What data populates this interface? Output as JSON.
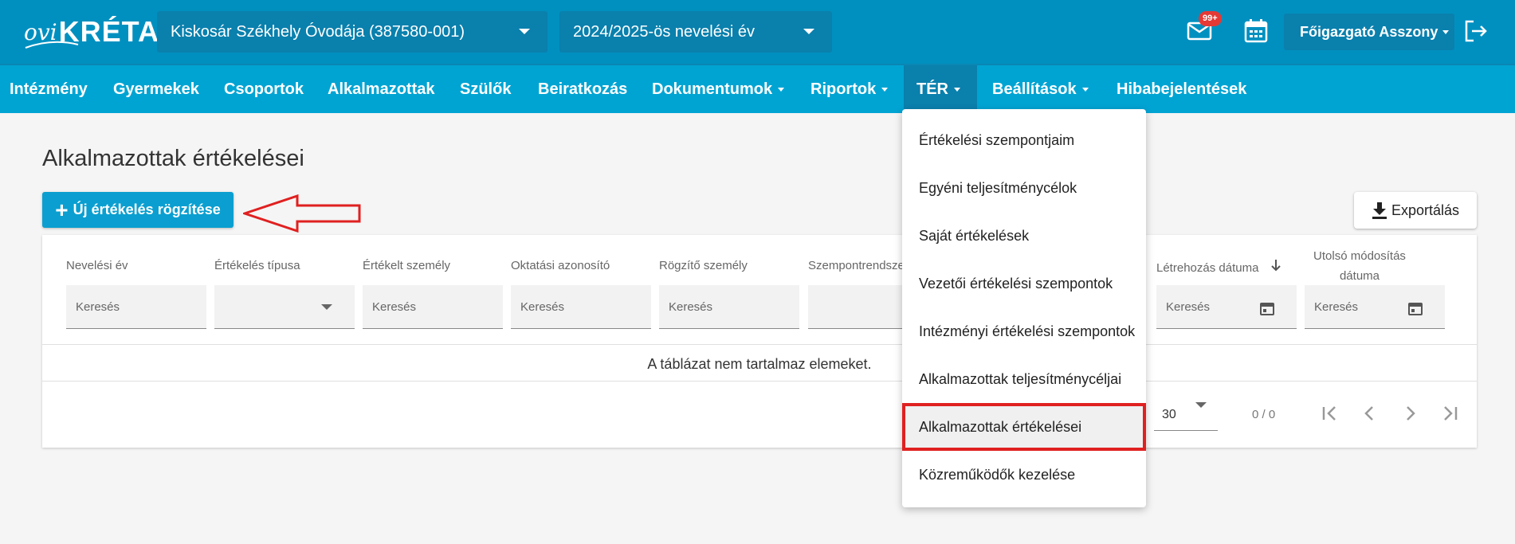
{
  "header": {
    "logo_prefix": "ovi",
    "logo_main": "KRÉTA",
    "institution": "Kiskosár Székhely Óvodája (387580-001)",
    "school_year": "2024/2025-ös nevelési év",
    "mail_badge": "99+",
    "user_name": "Főigazgató Asszony"
  },
  "nav": {
    "items": [
      {
        "label": "Intézmény"
      },
      {
        "label": "Gyermekek"
      },
      {
        "label": "Csoportok"
      },
      {
        "label": "Alkalmazottak"
      },
      {
        "label": "Szülők"
      },
      {
        "label": "Beiratkozás"
      },
      {
        "label": "Dokumentumok"
      },
      {
        "label": "Riportok"
      },
      {
        "label": "TÉR"
      },
      {
        "label": "Beállítások"
      },
      {
        "label": "Hibabejelentések"
      }
    ]
  },
  "page": {
    "title": "Alkalmazottak értékelései",
    "new_button": "Új értékelés rögzítése",
    "export_button": "Exportálás"
  },
  "table": {
    "columns": [
      {
        "header": "Nevelési év",
        "filter_placeholder": "Keresés"
      },
      {
        "header": "Értékelés típusa",
        "filter_placeholder": ""
      },
      {
        "header": "Értékelt személy",
        "filter_placeholder": "Keresés"
      },
      {
        "header": "Oktatási azonosító",
        "filter_placeholder": "Keresés"
      },
      {
        "header": "Rögzítő személy",
        "filter_placeholder": "Keresés"
      },
      {
        "header": "Szempontrendsze",
        "filter_placeholder": ""
      },
      {
        "header": "Létrehozás dátuma",
        "filter_placeholder": "Keresés"
      },
      {
        "header_line1": "Utolsó módosítás",
        "header_line2": "dátuma",
        "filter_placeholder": "Keresés"
      }
    ],
    "empty_message": "A táblázat nem tartalmaz elemeket.",
    "page_size": "30",
    "page_count": "0 / 0"
  },
  "dropdown": {
    "items": [
      {
        "label": "Értékelési szempontjaim"
      },
      {
        "label": "Egyéni teljesítménycélok"
      },
      {
        "label": "Saját értékelések"
      },
      {
        "label": "Vezetői értékelési szempontok"
      },
      {
        "label": "Intézményi értékelési szempontok"
      },
      {
        "label": "Alkalmazottak teljesítménycéljai"
      },
      {
        "label": "Alkalmazottak értékelései"
      },
      {
        "label": "Közreműködők kezelése"
      }
    ]
  },
  "colors": {
    "topbar": "#0090c0",
    "navbar": "#00a4d3",
    "primary_button": "#0a9fd0",
    "highlight_border": "#e02020"
  }
}
